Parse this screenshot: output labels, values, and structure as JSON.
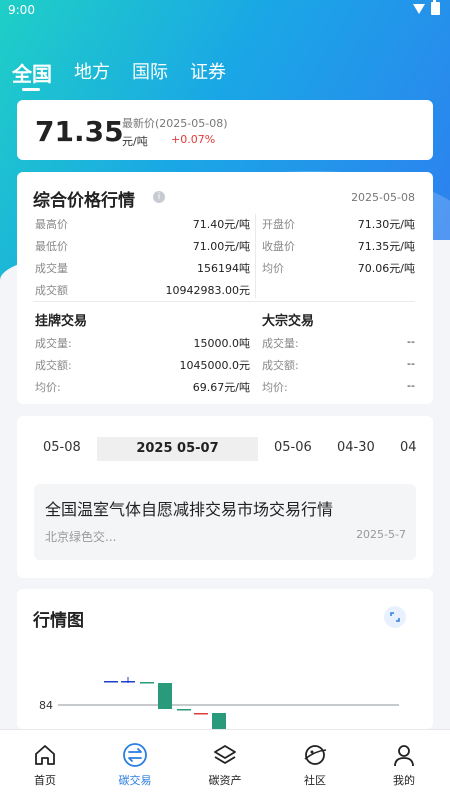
{
  "status_bar": {
    "time": "9:00"
  },
  "top_tabs": [
    {
      "label": "全国",
      "active": true
    },
    {
      "label": "地方",
      "active": false
    },
    {
      "label": "国际",
      "active": false
    },
    {
      "label": "证券",
      "active": false
    }
  ],
  "price_card": {
    "price": "71.35",
    "latest_label": "最新价(2025-05-08)",
    "unit": "元/吨",
    "change": "+0.07%"
  },
  "overview": {
    "title": "综合价格行情",
    "info_icon": "i",
    "date": "2025-05-08",
    "left_stats": [
      {
        "label": "最高价",
        "value": "71.40元/吨"
      },
      {
        "label": "最低价",
        "value": "71.00元/吨"
      },
      {
        "label": "成交量",
        "value": "156194吨"
      },
      {
        "label": "成交额",
        "value": "10942983.00元"
      }
    ],
    "right_stats": [
      {
        "label": "开盘价",
        "value": "71.30元/吨"
      },
      {
        "label": "收盘价",
        "value": "71.35元/吨"
      },
      {
        "label": "均价",
        "value": "70.06元/吨"
      }
    ],
    "listing": {
      "title": "挂牌交易",
      "rows": [
        {
          "label": "成交量:",
          "value": "15000.0吨"
        },
        {
          "label": "成交额:",
          "value": "1045000.0元"
        },
        {
          "label": "均价:",
          "value": "69.67元/吨"
        }
      ]
    },
    "bulk": {
      "title": "大宗交易",
      "rows": [
        {
          "label": "成交量:",
          "value": "--"
        },
        {
          "label": "成交额:",
          "value": "--"
        },
        {
          "label": "均价:",
          "value": "--"
        }
      ]
    }
  },
  "news": {
    "dates": [
      "05-08",
      "2025 05-07",
      "05-06",
      "04-30",
      "04"
    ],
    "selected_index": 1,
    "item": {
      "title": "全国温室气体自愿减排交易市场交易行情",
      "source": "北京绿色交...",
      "date": "2025-5-7"
    }
  },
  "chart": {
    "title": "行情图",
    "y_tick_label": "84",
    "colors": {
      "up": "#1a9c7a",
      "down": "#1a3fd0",
      "rise": "#2a9a7c"
    }
  },
  "chart_data": {
    "type": "candlestick",
    "title": "行情图",
    "y_ticks": [
      84
    ],
    "candles": [
      {
        "kind": "flat",
        "color": "blue"
      },
      {
        "kind": "flat",
        "color": "blue"
      },
      {
        "kind": "flat",
        "color": "green"
      },
      {
        "kind": "body",
        "color": "green"
      },
      {
        "kind": "flat",
        "color": "green"
      },
      {
        "kind": "flat",
        "color": "red"
      },
      {
        "kind": "body",
        "color": "green"
      }
    ]
  },
  "bottom_nav": [
    {
      "label": "首页",
      "icon": "home-icon",
      "active": false
    },
    {
      "label": "碳交易",
      "icon": "exchange-icon",
      "active": true
    },
    {
      "label": "碳资产",
      "icon": "layers-icon",
      "active": false
    },
    {
      "label": "社区",
      "icon": "planet-icon",
      "active": false
    },
    {
      "label": "我的",
      "icon": "user-icon",
      "active": false
    }
  ]
}
